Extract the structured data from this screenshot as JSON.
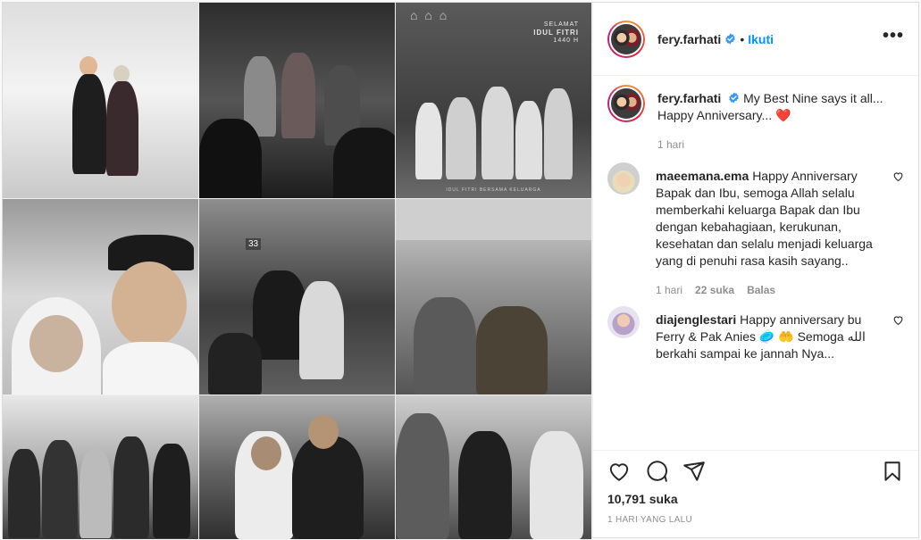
{
  "post": {
    "username": "fery.farhati",
    "follow_label": "Ikuti",
    "more_label": "•••",
    "separator": "•"
  },
  "media": {
    "greeting_line1": "SELAMAT",
    "greeting_line2": "IDUL FITRI",
    "greeting_line3": "1440 H",
    "house_number": "33",
    "card_footer": "IDUL FITRI BERSAMA KELUARGA"
  },
  "caption": {
    "username": "fery.farhati",
    "text_line1": "My Best Nine says it all...",
    "text_line2": "Happy Anniversary...",
    "emoji": "❤️",
    "time": "1 hari"
  },
  "comments": [
    {
      "username": "maeemana.ema",
      "text": "Happy Anniversary Bapak dan Ibu, semoga Allah selalu memberkahi keluarga Bapak dan Ibu dengan kebahagiaan, kerukunan, kesehatan dan selalu menjadi keluarga yang di penuhi rasa kasih sayang..",
      "time": "1 hari",
      "likes": "22 suka",
      "reply_label": "Balas"
    },
    {
      "username": "diajenglestari",
      "text": "Happy anniversary bu Ferry & Pak Anies 🥏 🤲 Semoga الله berkahi sampai ke jannah Nya..."
    }
  ],
  "footer": {
    "likes": "10,791 suka",
    "posted": "1 HARI YANG LALU"
  },
  "colors": {
    "accent": "#0095f6",
    "verified": "#3897f0",
    "heart": "#ed4956",
    "muted": "#8e8e8e"
  },
  "icons": [
    "heart-icon",
    "comment-icon",
    "share-icon",
    "bookmark-icon",
    "verified-icon",
    "more-icon"
  ]
}
